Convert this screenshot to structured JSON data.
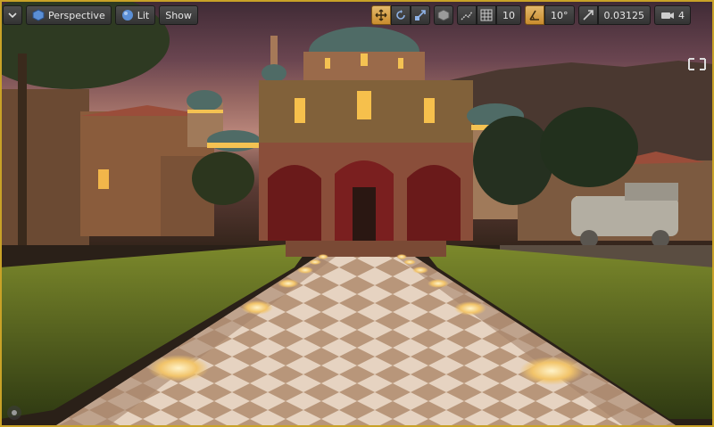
{
  "toolbar": {
    "perspective_label": "Perspective",
    "lit_label": "Lit",
    "show_label": "Show",
    "grid_snap_value": "10",
    "rotation_snap_value": "10°",
    "scale_snap_value": "0.03125",
    "camera_speed_value": "4"
  },
  "icons": {
    "menu": "chevron-down-icon",
    "perspective": "cube-icon",
    "lit": "sphere-icon",
    "translate": "move-icon",
    "rotate": "rotate-icon",
    "scale": "scale-icon",
    "world": "cube-icon",
    "surface": "surface-snap-icon",
    "grid": "grid-icon",
    "rotation": "angle-icon",
    "scale_snap": "scale-arrow-icon",
    "camera": "camera-icon"
  },
  "colors": {
    "accent": "#c9a227",
    "active_button": "#d9a34c"
  }
}
